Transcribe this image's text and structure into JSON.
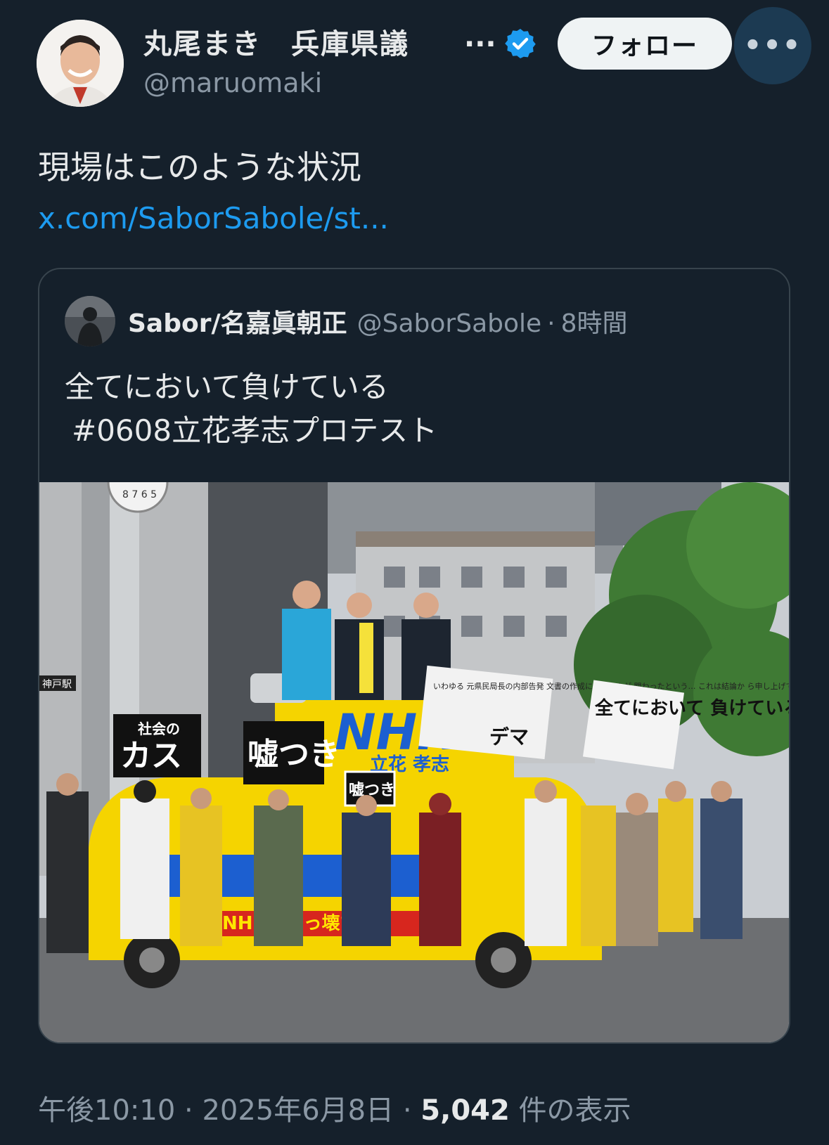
{
  "author": {
    "name": "丸尾まき　兵庫県議",
    "name_overflow": "...",
    "handle": "@maruomaki"
  },
  "actions": {
    "follow_label": "フォロー",
    "more_label": "•••"
  },
  "tweet": {
    "text": "現場はこのような状況",
    "link": "x.com/SaborSabole/st..."
  },
  "quote": {
    "name": "Sabor/名嘉眞朝正",
    "handle": "@SaborSabole",
    "dot": "·",
    "time": "8時間",
    "text_line1": "全てにおいて負けている",
    "text_line2": "#0608立花孝志プロテスト",
    "image": {
      "clock_numbers": "8 7 6 5",
      "station_sign": "神戸駅",
      "signs": {
        "left_small": "社会の",
        "left_big": "カス",
        "mid": "嘘つき",
        "mid_small": "嘘つき",
        "banner_text": "いわゆる\n元県民局長の内部告発\n文書の作成に丸尾さんが\n関わったという…\nこれは結論か\nら申し上げて\nです。間違いないです。",
        "banner_big": "デマ",
        "right": "全てにおいて\n負けている"
      },
      "car": {
        "brand": "NHK",
        "candidate": "立花 孝志",
        "party": "NHKをぶっ壊す!"
      }
    }
  },
  "footer": {
    "time": "午後10:10",
    "sep1": " · ",
    "date": "2025年6月8日",
    "sep2": " · ",
    "views_count": "5,042",
    "views_label": " 件の表示"
  },
  "colors": {
    "background": "#15202b",
    "text": "#e7e9ea",
    "secondary": "#8b98a5",
    "link": "#1d9bf0",
    "verified": "#1d9bf0",
    "car_yellow": "#f5d400",
    "car_blue": "#1c5fd0"
  }
}
